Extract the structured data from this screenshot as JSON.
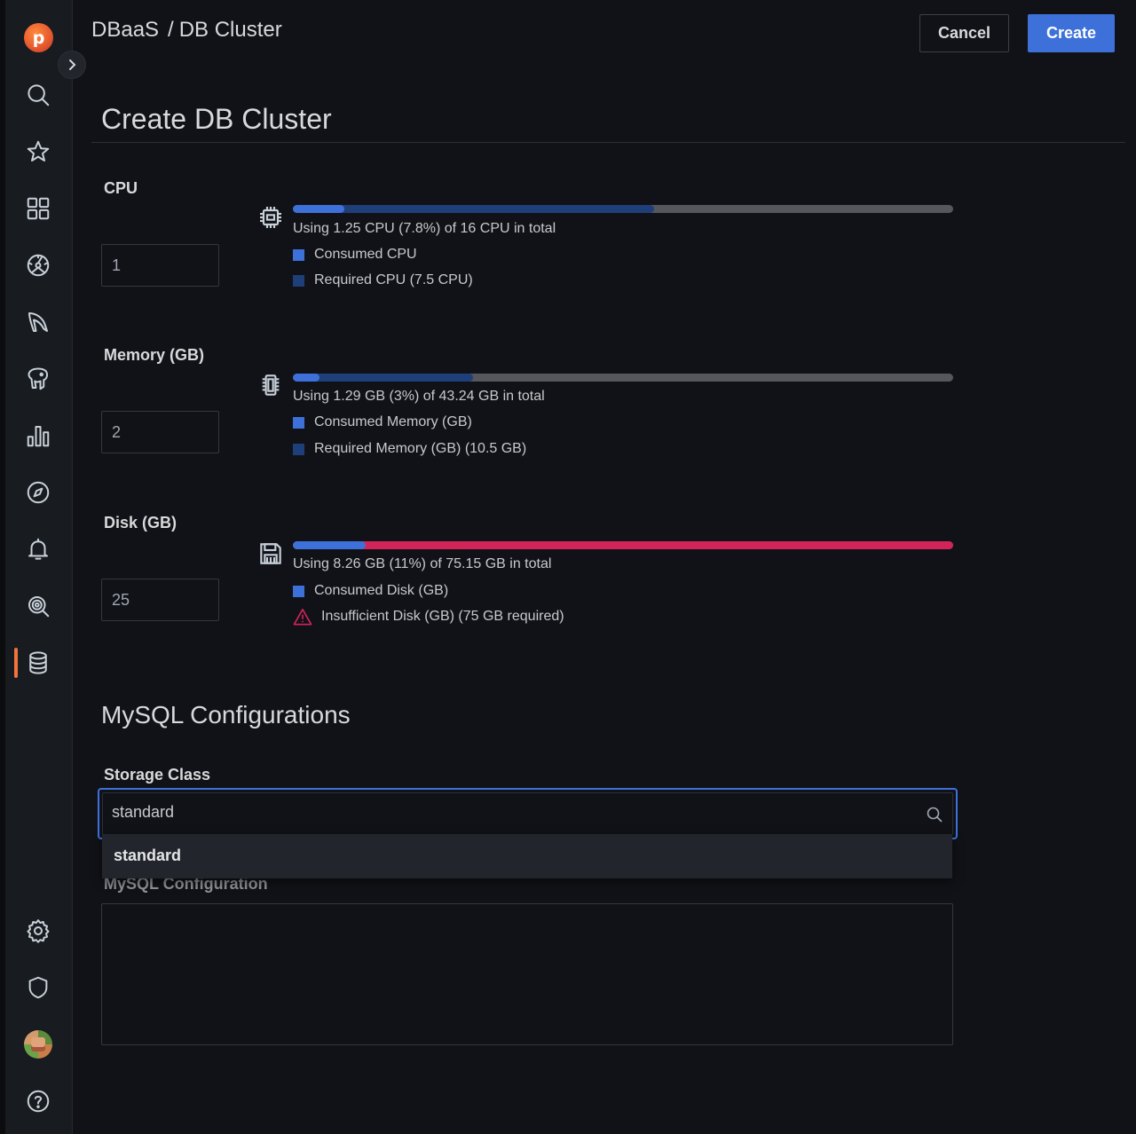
{
  "header": {
    "breadcrumb_root": "DBaaS",
    "breadcrumb_separator": "/",
    "breadcrumb_current": "DB Cluster",
    "cancel_label": "Cancel",
    "create_label": "Create"
  },
  "page_title": "Create DB Cluster",
  "sidebar": {
    "logo_letter": "p",
    "items": [
      {
        "icon": "search-icon"
      },
      {
        "icon": "star-icon"
      },
      {
        "icon": "dashboards-icon"
      },
      {
        "icon": "dashboard-gauge-icon"
      },
      {
        "icon": "mysql-dolphin-icon"
      },
      {
        "icon": "postgresql-elephant-icon"
      },
      {
        "icon": "bar-chart-icon"
      },
      {
        "icon": "compass-icon"
      },
      {
        "icon": "bell-icon"
      },
      {
        "icon": "qan-search-icon"
      },
      {
        "icon": "database-icon",
        "active": true
      },
      {
        "icon": "gear-icon"
      },
      {
        "icon": "shield-icon"
      },
      {
        "icon": "avatar"
      },
      {
        "icon": "help-icon"
      }
    ],
    "active_color": "#f0743c"
  },
  "resources": {
    "cpu": {
      "label": "CPU",
      "value": "1",
      "usage_text": "Using 1.25 CPU (7.8%) of 16 CPU in total",
      "consumed_fraction": 0.078,
      "required_fraction": 0.547,
      "legend_consumed": "Consumed CPU",
      "legend_required": "Required CPU (7.5 CPU)"
    },
    "memory": {
      "label": "Memory (GB)",
      "value": "2",
      "usage_text": "Using 1.29 GB (3%) of 43.24 GB in total",
      "consumed_fraction": 0.03,
      "required_fraction": 0.273,
      "legend_consumed": "Consumed Memory (GB)",
      "legend_required": "Required Memory (GB) (10.5 GB)"
    },
    "disk": {
      "label": "Disk (GB)",
      "value": "25",
      "usage_text": "Using 8.26 GB (11%) of 75.15 GB in total",
      "consumed_fraction": 0.11,
      "insufficient_fraction": 1.0,
      "legend_consumed": "Consumed Disk (GB)",
      "legend_insufficient": "Insufficient Disk (GB) (75 GB required)"
    }
  },
  "colors": {
    "consumed": "#3d71d9",
    "required": "#1f3f7a",
    "insufficient": "#d3245a",
    "track": "#55575c",
    "primary_button": "#3d71d9"
  },
  "mysql": {
    "section_title": "MySQL Configurations",
    "storage_class_label": "Storage Class",
    "storage_class_value": "standard",
    "dropdown_options": [
      "standard"
    ],
    "config_label": "MySQL Configuration",
    "config_value": ""
  }
}
